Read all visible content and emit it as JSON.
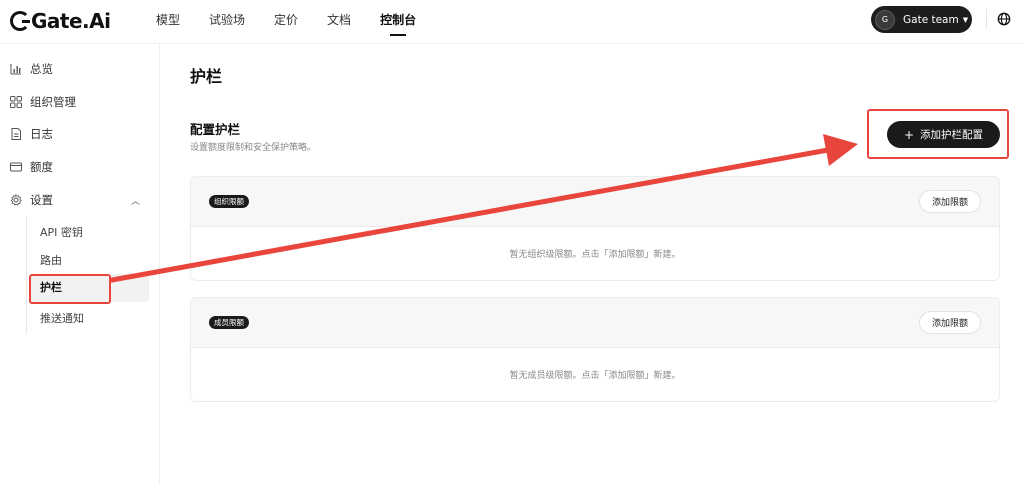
{
  "header": {
    "logo_text": "Gate.Ai",
    "nav": [
      "模型",
      "试验场",
      "定价",
      "文档",
      "控制台"
    ],
    "active_nav": "控制台",
    "team_avatar": "G",
    "team_name": "Gate team"
  },
  "sidebar": {
    "items": [
      {
        "label": "总览",
        "icon": "bar-chart-icon"
      },
      {
        "label": "组织管理",
        "icon": "grid-icon"
      },
      {
        "label": "日志",
        "icon": "document-icon"
      },
      {
        "label": "额度",
        "icon": "card-icon"
      },
      {
        "label": "设置",
        "icon": "gear-icon"
      }
    ],
    "settings_sub": [
      "API 密钥",
      "路由",
      "护栏",
      "推送通知"
    ],
    "active_sub": "护栏"
  },
  "main": {
    "page_title": "护栏",
    "section_title": "配置护栏",
    "section_desc": "设置额度限制和安全保护策略。",
    "add_config_button": "添加护栏配置",
    "cards": [
      {
        "badge": "组织限额",
        "button": "添加限额",
        "empty": "暂无组织级限额。点击「添加限额」新建。"
      },
      {
        "badge": "成员限额",
        "button": "添加限额",
        "empty": "暂无成员级限额。点击「添加限额」新建。"
      }
    ]
  },
  "colors": {
    "accent": "#1a1a1a",
    "annotation": "#e8453c"
  }
}
